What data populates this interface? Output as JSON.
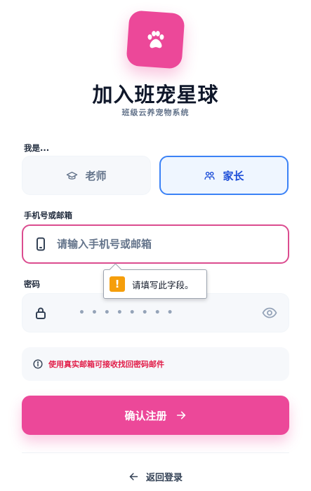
{
  "app": {
    "title": "加入班宠星球",
    "subtitle": "班级云养宠物系统",
    "brand_color": "#ec4899"
  },
  "role": {
    "label": "我是...",
    "options": [
      {
        "label": "老师",
        "icon": "graduation-cap-icon",
        "selected": false
      },
      {
        "label": "家长",
        "icon": "users-icon",
        "selected": true
      }
    ]
  },
  "contact": {
    "label": "手机号或邮箱",
    "placeholder": "请输入手机号或邮箱",
    "value": "",
    "icon": "phone-icon"
  },
  "validation": {
    "message": "请填写此字段。",
    "icon": "warning-icon"
  },
  "password": {
    "label": "密码",
    "masked_value": "••••••••",
    "icon": "lock-icon",
    "toggle_icon": "eye-icon"
  },
  "notice": {
    "text": "使用真实邮箱可接收找回密码邮件",
    "icon": "info-icon",
    "color": "#e11d48"
  },
  "submit": {
    "label": "确认注册",
    "icon": "arrow-right-icon"
  },
  "back": {
    "label": "返回登录",
    "icon": "arrow-left-icon"
  }
}
